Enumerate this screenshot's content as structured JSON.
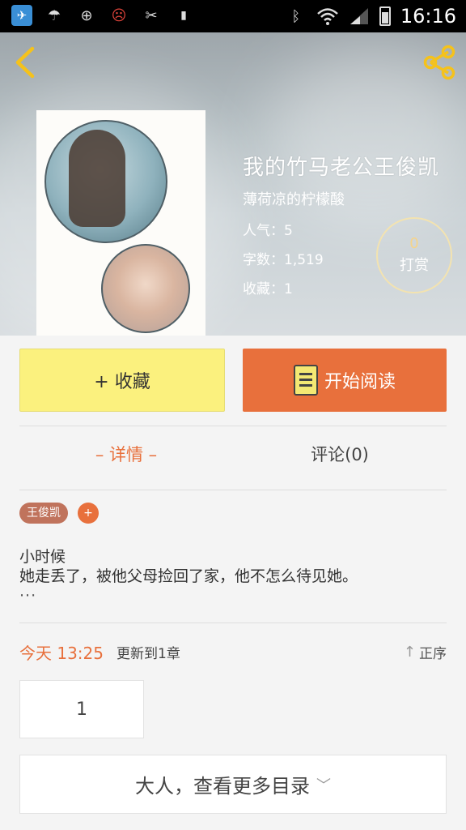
{
  "status_bar": {
    "time": "16:16",
    "icons": [
      "app-icon",
      "weather-rain-icon",
      "add-circle-icon",
      "sad-face-icon",
      "tools-icon",
      "lock-icon",
      "bluetooth-icon",
      "wifi-icon",
      "signal-icon",
      "battery-icon"
    ]
  },
  "header": {
    "back_icon": "chevron-left-icon",
    "share_icon": "share-icon"
  },
  "book": {
    "title": "我的竹马老公王俊凯",
    "author": "薄荷凉的柠檬酸",
    "popularity": "人气：5",
    "word_count": "字数：1,519",
    "favorites": "收藏：1",
    "tip_count": "0",
    "tip_label": "打赏"
  },
  "actions": {
    "favorite_label": "+ 收藏",
    "read_label": "开始阅读"
  },
  "tabs": {
    "detail": "– 详情 –",
    "comment": "评论(0)"
  },
  "tags": [
    {
      "label": "王俊凯"
    }
  ],
  "tag_add": "+",
  "intro": {
    "line1": "小时候",
    "line2": "她走丢了，被他父母捡回了家，他不怎么待见她。",
    "ellipsis": "···"
  },
  "update": {
    "time": "今天 13:25",
    "text": "更新到1章",
    "sort_label": "正序"
  },
  "chapters": [
    "1"
  ],
  "more_label": "大人，查看更多目录",
  "colors": {
    "accent_orange": "#e8703c",
    "favorite_yellow": "#fbf17e",
    "tag_brown": "#c0735c"
  }
}
